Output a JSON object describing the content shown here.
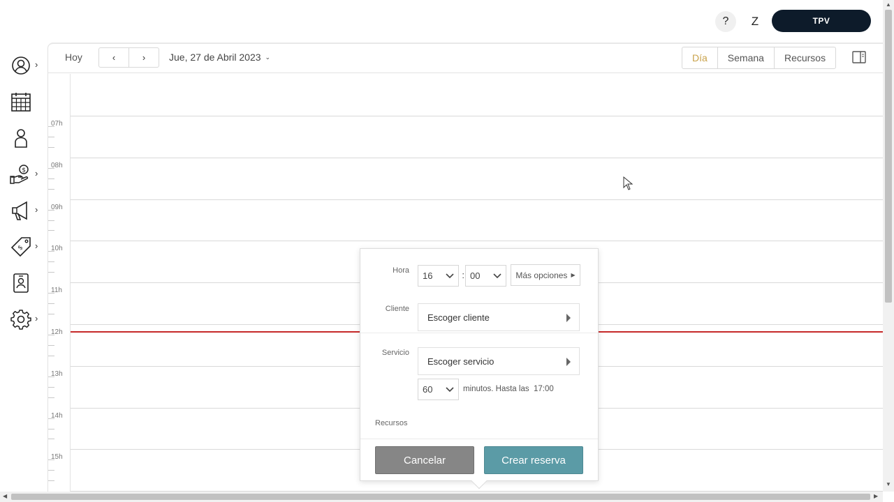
{
  "topbar": {
    "help_label": "?",
    "user_initial": "Z",
    "tpv_label": "TPV"
  },
  "sidebar": {
    "items": [
      {
        "name": "user-circle-icon",
        "has_submenu": true
      },
      {
        "name": "calendar-icon",
        "has_submenu": false
      },
      {
        "name": "person-icon",
        "has_submenu": false
      },
      {
        "name": "money-hand-icon",
        "has_submenu": true
      },
      {
        "name": "megaphone-icon",
        "has_submenu": true
      },
      {
        "name": "price-tag-icon",
        "has_submenu": true
      },
      {
        "name": "contact-card-icon",
        "has_submenu": false
      },
      {
        "name": "gear-icon",
        "has_submenu": true
      }
    ]
  },
  "toolbar": {
    "today_label": "Hoy",
    "prev_label": "‹",
    "next_label": "›",
    "date_label": "Jue, 27 de Abril 2023",
    "views": [
      {
        "label": "Día",
        "active": true
      },
      {
        "label": "Semana",
        "active": false
      },
      {
        "label": "Recursos",
        "active": false
      }
    ]
  },
  "grid": {
    "hours": [
      "07h",
      "08h",
      "09h",
      "10h",
      "11h",
      "12h",
      "13h",
      "14h",
      "15h"
    ]
  },
  "popup": {
    "hora_label": "Hora",
    "hour_value": "16",
    "minute_value": "00",
    "time_separator": ":",
    "more_options_label": "Más opciones",
    "cliente_label": "Cliente",
    "cliente_placeholder": "Escoger cliente",
    "servicio_label": "Servicio",
    "servicio_placeholder": "Escoger servicio",
    "duration_value": "60",
    "duration_text": "minutos. Hasta las",
    "end_time": "17:00",
    "recursos_label": "Recursos",
    "cancel_label": "Cancelar",
    "create_label": "Crear reserva"
  },
  "colors": {
    "accent_active": "#c9a24a",
    "tpv_bg": "#0d1b2a",
    "now_line": "#c62828",
    "create_button": "#5b9ba6",
    "cancel_button": "#868686"
  }
}
